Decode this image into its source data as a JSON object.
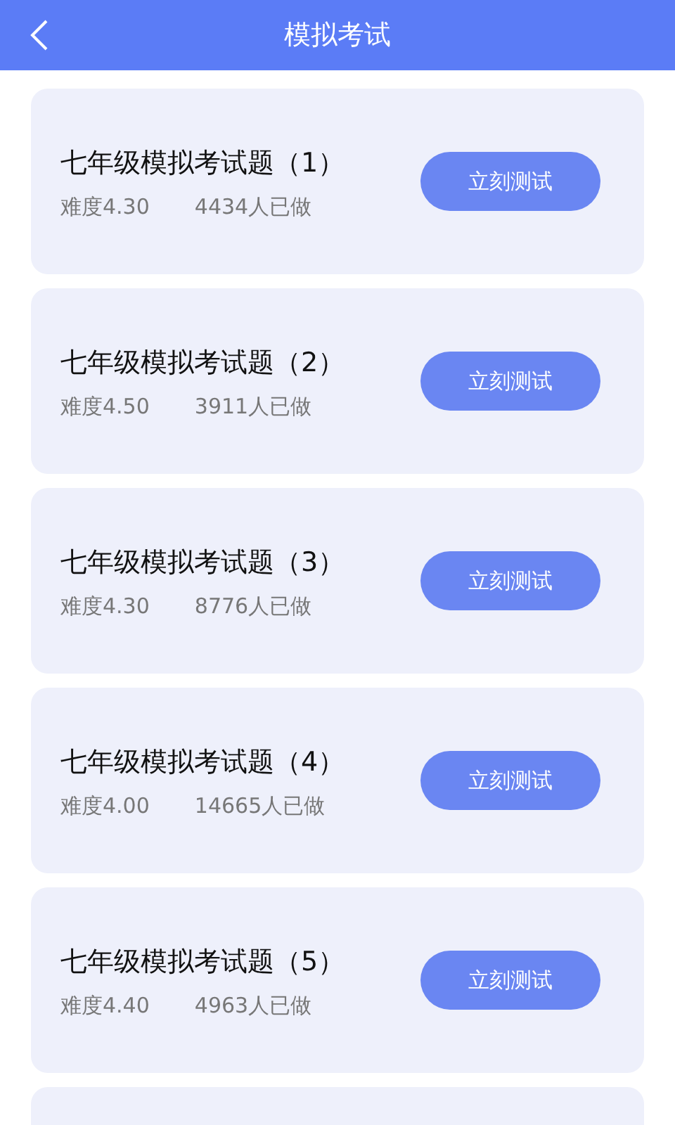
{
  "header": {
    "title": "模拟考试"
  },
  "exams": [
    {
      "title": "七年级模拟考试题（1）",
      "difficulty": "难度4.30",
      "count": "4434人已做",
      "button": "立刻测试"
    },
    {
      "title": "七年级模拟考试题（2）",
      "difficulty": "难度4.50",
      "count": "3911人已做",
      "button": "立刻测试"
    },
    {
      "title": "七年级模拟考试题（3）",
      "difficulty": "难度4.30",
      "count": "8776人已做",
      "button": "立刻测试"
    },
    {
      "title": "七年级模拟考试题（4）",
      "difficulty": "难度4.00",
      "count": "14665人已做",
      "button": "立刻测试"
    },
    {
      "title": "七年级模拟考试题（5）",
      "difficulty": "难度4.40",
      "count": "4963人已做",
      "button": "立刻测试"
    }
  ]
}
